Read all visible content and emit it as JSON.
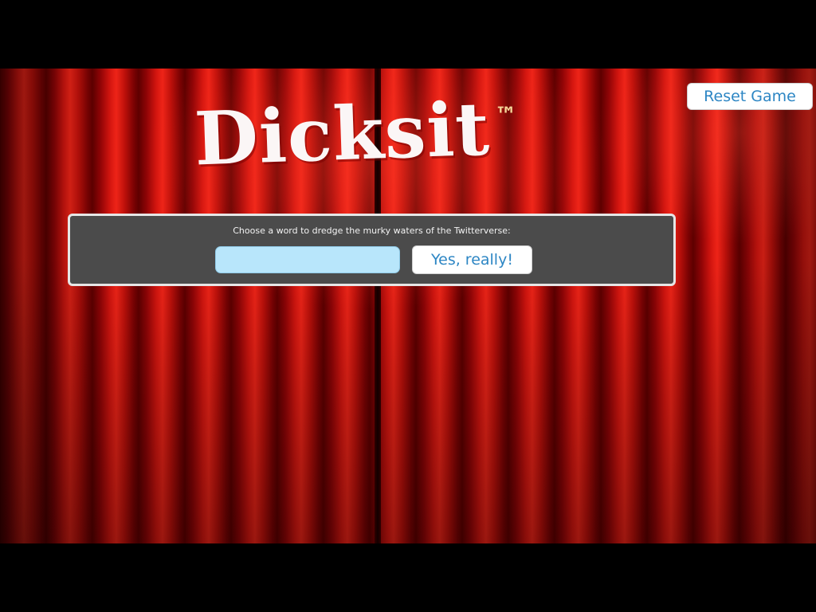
{
  "header": {
    "reset_label": "Reset Game"
  },
  "logo": {
    "text": "Dicksit",
    "trademark": "™"
  },
  "prompt": {
    "instruction": "Choose a word to dredge the murky waters of the Twitterverse:",
    "input_value": "",
    "submit_label": "Yes, really!"
  },
  "colors": {
    "curtain": "#d3150f",
    "panel": "#4b4b4b",
    "input_fill": "#b8e6fb",
    "button_text": "#2d86c4",
    "trademark": "#f5d79a"
  }
}
